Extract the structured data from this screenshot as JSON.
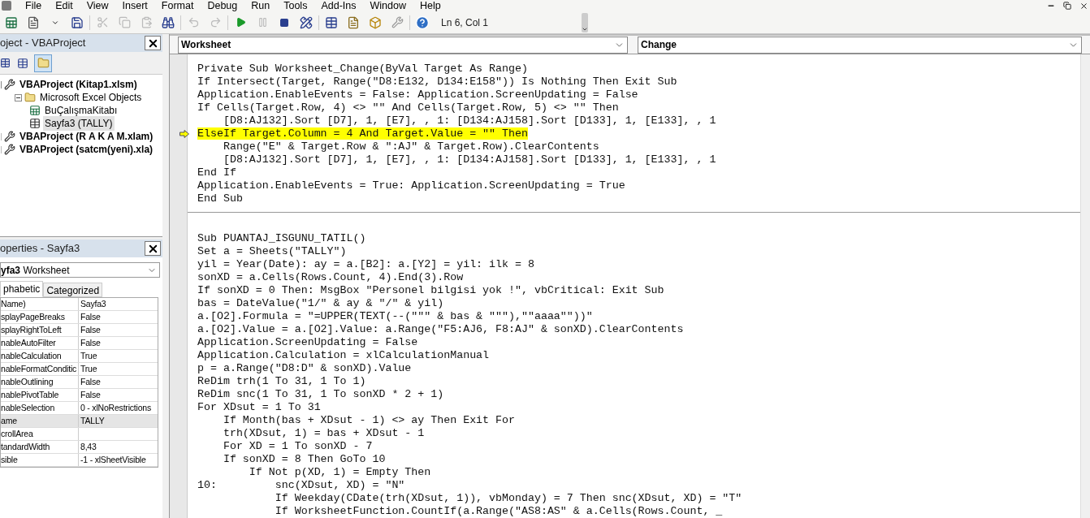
{
  "menu_bar": [
    "File",
    "Edit",
    "View",
    "Insert",
    "Format",
    "Debug",
    "Run",
    "Tools",
    "Add-Ins",
    "Window",
    "Help"
  ],
  "toolbar": {
    "position": "Ln 6, Col 1"
  },
  "project_explorer": {
    "title": "oject - VBAProject",
    "tree": [
      {
        "label": "VBAProject (Kitap1.xlsm)",
        "kind": "project",
        "expanded": true,
        "children": [
          {
            "label": "Microsoft Excel Objects",
            "kind": "folder",
            "expanded": true,
            "children": [
              {
                "label": "BuÇalışmaKitabı",
                "kind": "workbook",
                "selected": false
              },
              {
                "label": "Sayfa3 (TALLY)",
                "kind": "sheet",
                "selected": true
              }
            ]
          }
        ]
      },
      {
        "label": "VBAProject (R A K A M.xlam)",
        "kind": "project",
        "expanded": false
      },
      {
        "label": "VBAProject (satcm(yeni).xla)",
        "kind": "project",
        "expanded": false
      }
    ]
  },
  "properties": {
    "title": "operties - Sayfa3",
    "object_name": "yfa3",
    "object_type": "Worksheet",
    "tabs": [
      {
        "label": "phabetic",
        "selected": true
      },
      {
        "label": "Categorized",
        "selected": false
      }
    ],
    "rows": [
      {
        "name": "Name)",
        "value": "Sayfa3",
        "selected": false
      },
      {
        "name": "splayPageBreaks",
        "value": "False",
        "selected": false
      },
      {
        "name": "splayRightToLeft",
        "value": "False",
        "selected": false
      },
      {
        "name": "nableAutoFilter",
        "value": "False",
        "selected": false
      },
      {
        "name": "nableCalculation",
        "value": "True",
        "selected": false
      },
      {
        "name": "nableFormatConditic",
        "value": "True",
        "selected": false
      },
      {
        "name": "nableOutlining",
        "value": "False",
        "selected": false
      },
      {
        "name": "nablePivotTable",
        "value": "False",
        "selected": false
      },
      {
        "name": "nableSelection",
        "value": "0 - xlNoRestrictions",
        "selected": false
      },
      {
        "name": "ame",
        "value": "TALLY",
        "selected": true
      },
      {
        "name": "crollArea",
        "selected": false
      },
      {
        "name": "tandardWidth",
        "value": "8,43",
        "selected": false
      },
      {
        "name": "sible",
        "value": "-1 - xlSheetVisible",
        "selected": false
      }
    ]
  },
  "code_window": {
    "object_dropdown": "Worksheet",
    "procedure_dropdown": "Change",
    "procedures": [
      {
        "lines": [
          {
            "text": "Private Sub Worksheet_Change(ByVal Target As Range)",
            "current": false
          },
          {
            "text": "If Intersect(Target, Range(\"D8:E132, D134:E158\")) Is Nothing Then Exit Sub",
            "current": false
          },
          {
            "text": "Application.EnableEvents = False: Application.ScreenUpdating = False",
            "current": false
          },
          {
            "text": "If Cells(Target.Row, 4) <> \"\" And Cells(Target.Row, 5) <> \"\" Then",
            "current": false
          },
          {
            "text": "    [D8:AJ132].Sort [D7], 1, [E7], , 1: [D134:AJ158].Sort [D133], 1, [E133], , 1",
            "current": false
          },
          {
            "text": "ElseIf Target.Column = 4 And Target.Value = \"\" Then",
            "current": true
          },
          {
            "text": "    Range(\"E\" & Target.Row & \":AJ\" & Target.Row).ClearContents",
            "current": false
          },
          {
            "text": "    [D8:AJ132].Sort [D7], 1, [E7], , 1: [D134:AJ158].Sort [D133], 1, [E133], , 1",
            "current": false
          },
          {
            "text": "End If",
            "current": false
          },
          {
            "text": "Application.EnableEvents = True: Application.ScreenUpdating = True",
            "current": false
          },
          {
            "text": "End Sub",
            "current": false
          }
        ]
      },
      {
        "lines": [
          {
            "text": "Sub PUANTAJ_ISGUNU_TATIL()",
            "current": false
          },
          {
            "text": "Set a = Sheets(\"TALLY\")",
            "current": false
          },
          {
            "text": "yil = Year(Date): ay = a.[B2]: a.[Y2] = yil: ilk = 8",
            "current": false
          },
          {
            "text": "sonXD = a.Cells(Rows.Count, 4).End(3).Row",
            "current": false
          },
          {
            "text": "If sonXD = 0 Then: MsgBox \"Personel bilgisi yok !\", vbCritical: Exit Sub",
            "current": false
          },
          {
            "text": "bas = DateValue(\"1/\" & ay & \"/\" & yil)",
            "current": false
          },
          {
            "text": "a.[O2].Formula = \"=UPPER(TEXT(--(\"\"\" & bas & \"\"\"),\"\"aaaa\"\"))\"",
            "current": false
          },
          {
            "text": "a.[O2].Value = a.[O2].Value: a.Range(\"F5:AJ6, F8:AJ\" & sonXD).ClearContents",
            "current": false
          },
          {
            "text": "Application.ScreenUpdating = False",
            "current": false
          },
          {
            "text": "Application.Calculation = xlCalculationManual",
            "current": false
          },
          {
            "text": "p = a.Range(\"D8:D\" & sonXD).Value",
            "current": false
          },
          {
            "text": "ReDim trh(1 To 31, 1 To 1)",
            "current": false
          },
          {
            "text": "ReDim snc(1 To 31, 1 To sonXD * 2 + 1)",
            "current": false
          },
          {
            "text": "For XDsut = 1 To 31",
            "current": false
          },
          {
            "text": "    If Month(bas + XDsut - 1) <> ay Then Exit For",
            "current": false
          },
          {
            "text": "    trh(XDsut, 1) = bas + XDsut - 1",
            "current": false
          },
          {
            "text": "    For XD = 1 To sonXD - 7",
            "current": false
          },
          {
            "text": "    If sonXD = 8 Then GoTo 10",
            "current": false
          },
          {
            "text": "        If Not p(XD, 1) = Empty Then",
            "current": false
          },
          {
            "text": "10:         snc(XDsut, XD) = \"N\"",
            "current": false
          },
          {
            "text": "            If Weekday(CDate(trh(XDsut, 1)), vbMonday) = 7 Then snc(XDsut, XD) = \"T\"",
            "current": false
          },
          {
            "text": "            If WorksheetFunction.CountIf(a.Range(\"AS8:AS\" & a.Cells(Rows.Count, _",
            "current": false
          }
        ]
      }
    ]
  }
}
